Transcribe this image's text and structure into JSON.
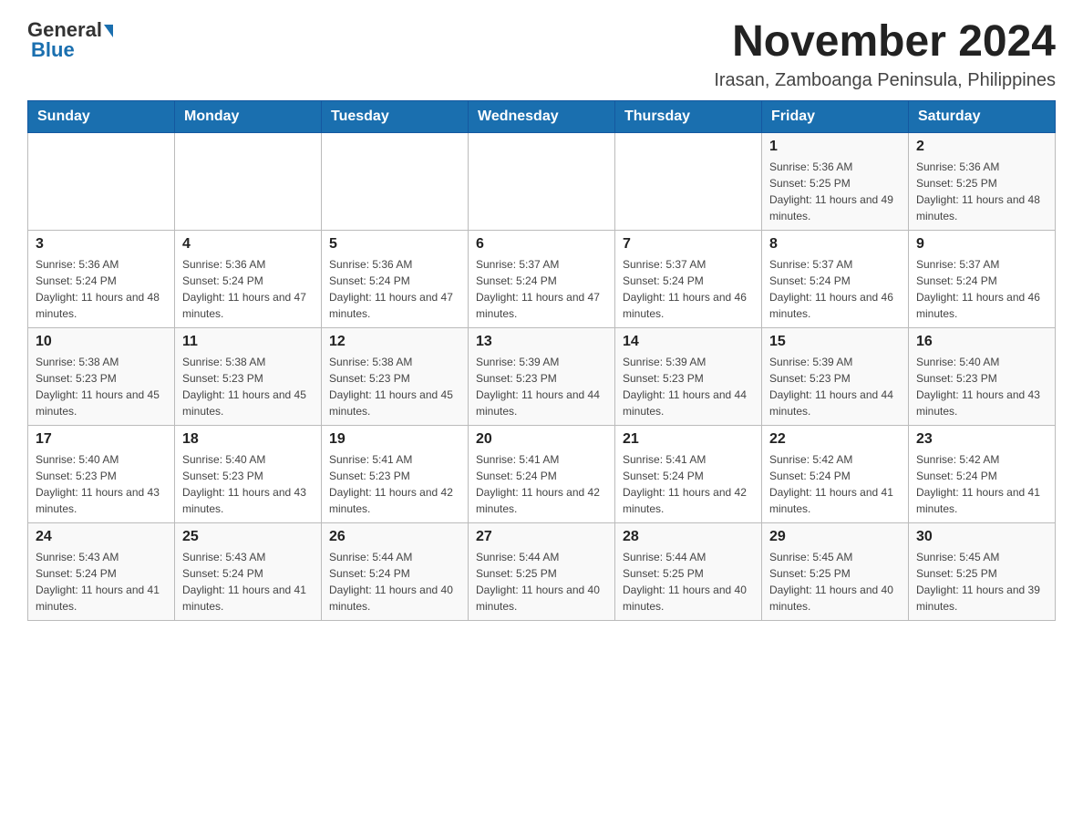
{
  "logo": {
    "general": "General",
    "blue": "Blue"
  },
  "header": {
    "title": "November 2024",
    "subtitle": "Irasan, Zamboanga Peninsula, Philippines"
  },
  "weekdays": [
    "Sunday",
    "Monday",
    "Tuesday",
    "Wednesday",
    "Thursday",
    "Friday",
    "Saturday"
  ],
  "weeks": [
    [
      {
        "day": "",
        "info": ""
      },
      {
        "day": "",
        "info": ""
      },
      {
        "day": "",
        "info": ""
      },
      {
        "day": "",
        "info": ""
      },
      {
        "day": "",
        "info": ""
      },
      {
        "day": "1",
        "info": "Sunrise: 5:36 AM\nSunset: 5:25 PM\nDaylight: 11 hours and 49 minutes."
      },
      {
        "day": "2",
        "info": "Sunrise: 5:36 AM\nSunset: 5:25 PM\nDaylight: 11 hours and 48 minutes."
      }
    ],
    [
      {
        "day": "3",
        "info": "Sunrise: 5:36 AM\nSunset: 5:24 PM\nDaylight: 11 hours and 48 minutes."
      },
      {
        "day": "4",
        "info": "Sunrise: 5:36 AM\nSunset: 5:24 PM\nDaylight: 11 hours and 47 minutes."
      },
      {
        "day": "5",
        "info": "Sunrise: 5:36 AM\nSunset: 5:24 PM\nDaylight: 11 hours and 47 minutes."
      },
      {
        "day": "6",
        "info": "Sunrise: 5:37 AM\nSunset: 5:24 PM\nDaylight: 11 hours and 47 minutes."
      },
      {
        "day": "7",
        "info": "Sunrise: 5:37 AM\nSunset: 5:24 PM\nDaylight: 11 hours and 46 minutes."
      },
      {
        "day": "8",
        "info": "Sunrise: 5:37 AM\nSunset: 5:24 PM\nDaylight: 11 hours and 46 minutes."
      },
      {
        "day": "9",
        "info": "Sunrise: 5:37 AM\nSunset: 5:24 PM\nDaylight: 11 hours and 46 minutes."
      }
    ],
    [
      {
        "day": "10",
        "info": "Sunrise: 5:38 AM\nSunset: 5:23 PM\nDaylight: 11 hours and 45 minutes."
      },
      {
        "day": "11",
        "info": "Sunrise: 5:38 AM\nSunset: 5:23 PM\nDaylight: 11 hours and 45 minutes."
      },
      {
        "day": "12",
        "info": "Sunrise: 5:38 AM\nSunset: 5:23 PM\nDaylight: 11 hours and 45 minutes."
      },
      {
        "day": "13",
        "info": "Sunrise: 5:39 AM\nSunset: 5:23 PM\nDaylight: 11 hours and 44 minutes."
      },
      {
        "day": "14",
        "info": "Sunrise: 5:39 AM\nSunset: 5:23 PM\nDaylight: 11 hours and 44 minutes."
      },
      {
        "day": "15",
        "info": "Sunrise: 5:39 AM\nSunset: 5:23 PM\nDaylight: 11 hours and 44 minutes."
      },
      {
        "day": "16",
        "info": "Sunrise: 5:40 AM\nSunset: 5:23 PM\nDaylight: 11 hours and 43 minutes."
      }
    ],
    [
      {
        "day": "17",
        "info": "Sunrise: 5:40 AM\nSunset: 5:23 PM\nDaylight: 11 hours and 43 minutes."
      },
      {
        "day": "18",
        "info": "Sunrise: 5:40 AM\nSunset: 5:23 PM\nDaylight: 11 hours and 43 minutes."
      },
      {
        "day": "19",
        "info": "Sunrise: 5:41 AM\nSunset: 5:23 PM\nDaylight: 11 hours and 42 minutes."
      },
      {
        "day": "20",
        "info": "Sunrise: 5:41 AM\nSunset: 5:24 PM\nDaylight: 11 hours and 42 minutes."
      },
      {
        "day": "21",
        "info": "Sunrise: 5:41 AM\nSunset: 5:24 PM\nDaylight: 11 hours and 42 minutes."
      },
      {
        "day": "22",
        "info": "Sunrise: 5:42 AM\nSunset: 5:24 PM\nDaylight: 11 hours and 41 minutes."
      },
      {
        "day": "23",
        "info": "Sunrise: 5:42 AM\nSunset: 5:24 PM\nDaylight: 11 hours and 41 minutes."
      }
    ],
    [
      {
        "day": "24",
        "info": "Sunrise: 5:43 AM\nSunset: 5:24 PM\nDaylight: 11 hours and 41 minutes."
      },
      {
        "day": "25",
        "info": "Sunrise: 5:43 AM\nSunset: 5:24 PM\nDaylight: 11 hours and 41 minutes."
      },
      {
        "day": "26",
        "info": "Sunrise: 5:44 AM\nSunset: 5:24 PM\nDaylight: 11 hours and 40 minutes."
      },
      {
        "day": "27",
        "info": "Sunrise: 5:44 AM\nSunset: 5:25 PM\nDaylight: 11 hours and 40 minutes."
      },
      {
        "day": "28",
        "info": "Sunrise: 5:44 AM\nSunset: 5:25 PM\nDaylight: 11 hours and 40 minutes."
      },
      {
        "day": "29",
        "info": "Sunrise: 5:45 AM\nSunset: 5:25 PM\nDaylight: 11 hours and 40 minutes."
      },
      {
        "day": "30",
        "info": "Sunrise: 5:45 AM\nSunset: 5:25 PM\nDaylight: 11 hours and 39 minutes."
      }
    ]
  ]
}
